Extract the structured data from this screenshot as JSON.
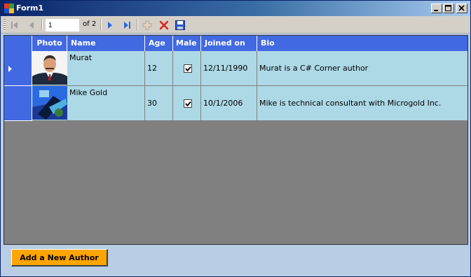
{
  "window": {
    "title": "Form1",
    "controls": {
      "minimize": "minimize",
      "maximize": "maximize",
      "close": "close"
    }
  },
  "toolbar": {
    "position_value": "1",
    "count_label": "of 2",
    "buttons": [
      "move-first",
      "move-previous",
      "move-next",
      "move-last",
      "add-new",
      "delete",
      "save"
    ]
  },
  "grid": {
    "columns": [
      "Photo",
      "Name",
      "Age",
      "Male",
      "Joined on",
      "Bio"
    ],
    "rows": [
      {
        "name": "Murat",
        "age": "12",
        "male": true,
        "joined": "12/11/1990",
        "bio": "Murat is a C# Corner author",
        "current": true
      },
      {
        "name": "Mike Gold",
        "age": "30",
        "male": true,
        "joined": "10/1/2006",
        "bio": "Mike is technical consultant with Microgold Inc.",
        "current": false
      }
    ],
    "colors": {
      "header": "#4169e1",
      "cell": "#add8e6",
      "empty": "#808080"
    }
  },
  "footer": {
    "add_button_label": "Add a New Author",
    "add_button_color": "#ffa500"
  }
}
